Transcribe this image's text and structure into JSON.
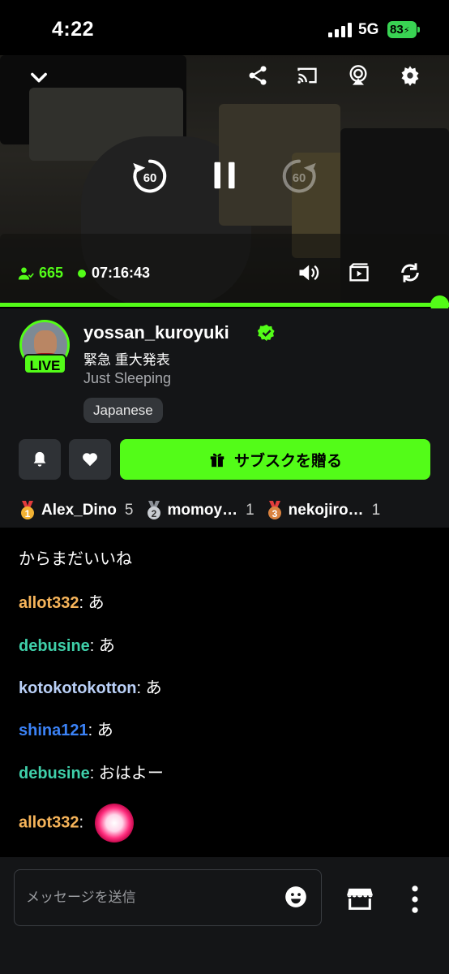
{
  "status_bar": {
    "time": "4:22",
    "network": "5G",
    "battery": "83"
  },
  "player": {
    "viewers": "665",
    "uptime": "07:16:43",
    "rewind_label": "60",
    "forward_label": "60",
    "progress": 1.0,
    "icons": [
      "chevron-down-icon",
      "share-icon",
      "cast-icon",
      "airplay-icon",
      "settings-icon",
      "rewind-60-icon",
      "pause-icon",
      "forward-60-icon",
      "volume-icon",
      "clip-icon",
      "rotate-icon"
    ]
  },
  "channel": {
    "name": "yossan_kuroyuki",
    "live_badge": "LIVE",
    "title": "緊急 重大発表",
    "category": "Just Sleeping",
    "language": "Japanese",
    "subscribe_button": "サブスクを贈る"
  },
  "leaderboard": [
    {
      "rank": "1",
      "name": "Alex_Dino",
      "count": "5"
    },
    {
      "rank": "2",
      "name": "momoy…",
      "count": "1"
    },
    {
      "rank": "3",
      "name": "nekojiro…",
      "count": "1"
    }
  ],
  "chat": {
    "partial_first_line": "からまだいいね",
    "messages": [
      {
        "user": "allot332",
        "color": "#f6b45a",
        "text": "あ"
      },
      {
        "user": "debusine",
        "color": "#3fcfa9",
        "text": "あ"
      },
      {
        "user": "kotokotokotton",
        "color": "#b9cff6",
        "text": "あ"
      },
      {
        "user": "shina121",
        "color": "#3b82f6",
        "text": "あ"
      },
      {
        "user": "debusine",
        "color": "#3fcfa9",
        "text": "おはよー"
      },
      {
        "user": "allot332",
        "color": "#f6b45a",
        "text": "",
        "emote": "heart-emote"
      }
    ]
  },
  "composer": {
    "placeholder": "メッセージを送信"
  },
  "colors": {
    "accent": "#53fc18",
    "panel": "#141517"
  }
}
